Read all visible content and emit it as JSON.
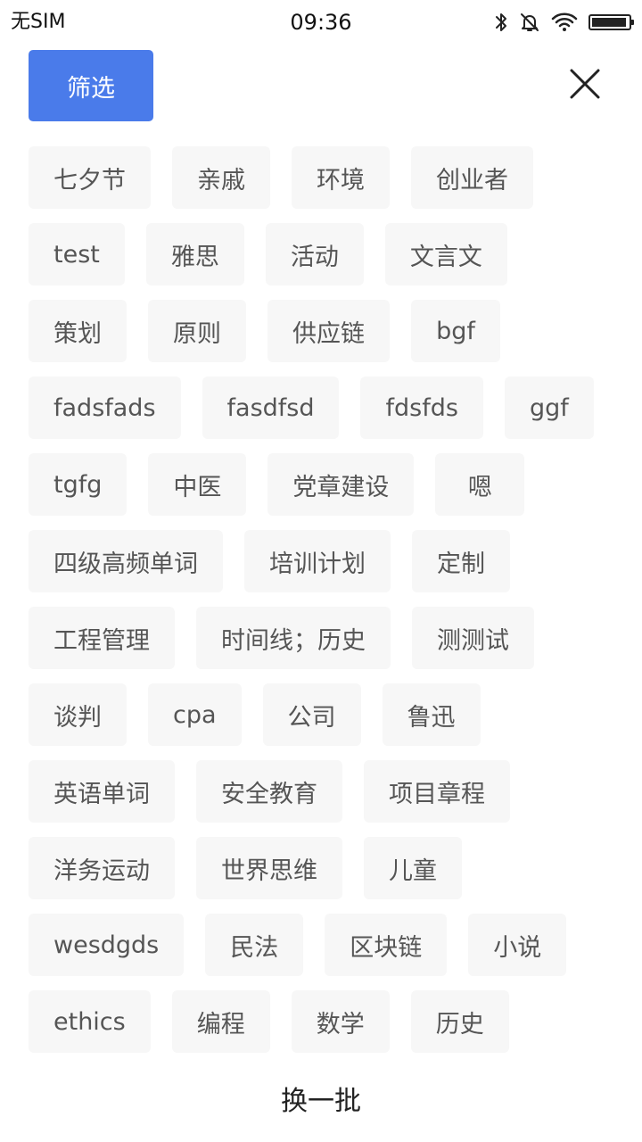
{
  "status_bar": {
    "carrier": "无SIM",
    "time": "09:36",
    "icons": [
      "bluetooth-icon",
      "mute-icon",
      "wifi-icon",
      "battery-icon"
    ],
    "battery_level": 0.95
  },
  "header": {
    "filter_label": "筛选",
    "filter_color": "#4a7bea",
    "close_icon": "close-icon"
  },
  "tags": [
    [
      "七夕节",
      "亲戚",
      "环境",
      "创业者"
    ],
    [
      "test",
      "雅思",
      "活动",
      "文言文"
    ],
    [
      "策划",
      "原则",
      "供应链",
      "bgf"
    ],
    [
      "fadsfads",
      "fasdfsd",
      "fdsfds",
      "ggf"
    ],
    [
      "tgfg",
      "中医",
      "党章建设",
      "嗯"
    ],
    [
      "四级高频单词",
      "培训计划",
      "定制"
    ],
    [
      "工程管理",
      "时间线；历史",
      "测测试"
    ],
    [
      "谈判",
      "cpa",
      "公司",
      "鲁迅"
    ],
    [
      "英语单词",
      "安全教育",
      "项目章程"
    ],
    [
      "洋务运动",
      "世界思维",
      "儿童"
    ],
    [
      "wesdgds",
      "民法",
      "区块链",
      "小说"
    ],
    [
      "ethics",
      "编程",
      "数学",
      "历史"
    ]
  ],
  "footer": {
    "refresh_label": "换一批"
  }
}
